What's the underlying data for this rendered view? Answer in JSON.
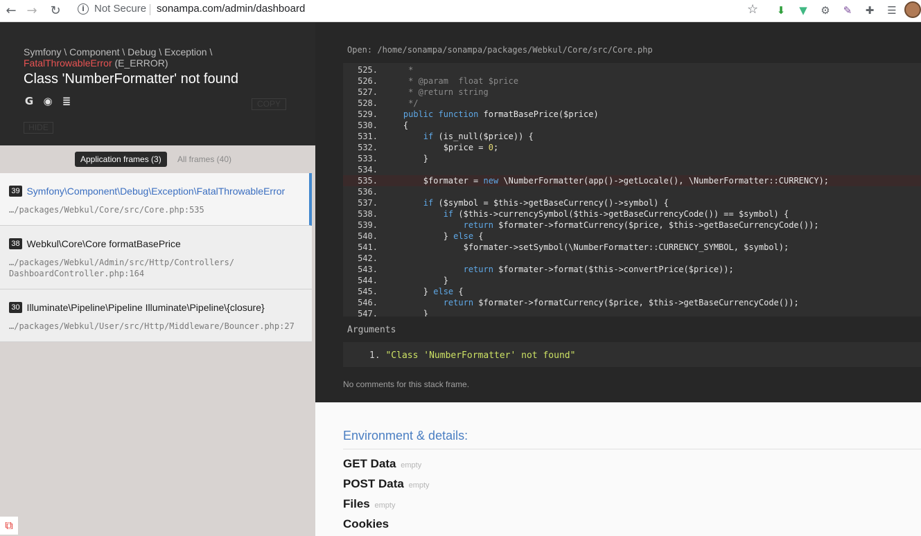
{
  "browser": {
    "not_secure_label": "Not Secure",
    "url": "sonampa.com/admin/dashboard"
  },
  "exception": {
    "path": "Symfony \\ Component \\ Debug \\ Exception \\",
    "type": "FatalThrowableError",
    "level": "(E_ERROR)",
    "message": "Class 'NumberFormatter' not found",
    "copy_label": "COPY",
    "hide_label": "HIDE"
  },
  "frame_tabs": {
    "application": "Application frames (3)",
    "all": "All frames (40)"
  },
  "frames": [
    {
      "num": "39",
      "class": "Symfony\\Component\\Debug\\Exception\\FatalThrowableError",
      "file": "…/packages/Webkul/Core/src/Core.php:535"
    },
    {
      "num": "38",
      "class": "Webkul\\Core\\Core formatBasePrice",
      "file": "…/packages/Webkul/Admin/src/Http/Controllers/",
      "file2": "DashboardController.php:164"
    },
    {
      "num": "30",
      "class": "Illuminate\\Pipeline\\Pipeline Illuminate\\Pipeline\\{closure}",
      "file": "…/packages/Webkul/User/src/Http/Middleware/Bouncer.php:27"
    }
  ],
  "code": {
    "open_label": "Open:",
    "open_path": "/home/sonampa/sonampa/packages/Webkul/Core/src/Core.php",
    "lines": [
      {
        "n": "525.",
        "t": "     *"
      },
      {
        "n": "526.",
        "t": "     * @param  float $price"
      },
      {
        "n": "527.",
        "t": "     * @return string"
      },
      {
        "n": "528.",
        "t": "     */"
      },
      {
        "n": "529.",
        "t": "    public function formatBasePrice($price)"
      },
      {
        "n": "530.",
        "t": "    {"
      },
      {
        "n": "531.",
        "t": "        if (is_null($price)) {"
      },
      {
        "n": "532.",
        "t": "            $price = 0;"
      },
      {
        "n": "533.",
        "t": "        }"
      },
      {
        "n": "534.",
        "t": ""
      },
      {
        "n": "535.",
        "t": "        $formater = new \\NumberFormatter(app()->getLocale(), \\NumberFormatter::CURRENCY);"
      },
      {
        "n": "536.",
        "t": ""
      },
      {
        "n": "537.",
        "t": "        if ($symbol = $this->getBaseCurrency()->symbol) {"
      },
      {
        "n": "538.",
        "t": "            if ($this->currencySymbol($this->getBaseCurrencyCode()) == $symbol) {"
      },
      {
        "n": "539.",
        "t": "                return $formater->formatCurrency($price, $this->getBaseCurrencyCode());"
      },
      {
        "n": "540.",
        "t": "            } else {"
      },
      {
        "n": "541.",
        "t": "                $formater->setSymbol(\\NumberFormatter::CURRENCY_SYMBOL, $symbol);"
      },
      {
        "n": "542.",
        "t": ""
      },
      {
        "n": "543.",
        "t": "                return $formater->format($this->convertPrice($price));"
      },
      {
        "n": "544.",
        "t": "            }"
      },
      {
        "n": "545.",
        "t": "        } else {"
      },
      {
        "n": "546.",
        "t": "            return $formater->formatCurrency($price, $this->getBaseCurrencyCode());"
      },
      {
        "n": "547.",
        "t": "        }"
      }
    ],
    "highlight_line": "535."
  },
  "arguments": {
    "label": "Arguments",
    "items": [
      {
        "index": "1.",
        "value": "\"Class 'NumberFormatter' not found\""
      }
    ]
  },
  "no_comments": "No comments for this stack frame.",
  "environment": {
    "title": "Environment & details:",
    "sections": [
      {
        "name": "GET Data",
        "state": "empty"
      },
      {
        "name": "POST Data",
        "state": "empty"
      },
      {
        "name": "Files",
        "state": "empty"
      },
      {
        "name": "Cookies",
        "state": ""
      }
    ]
  }
}
